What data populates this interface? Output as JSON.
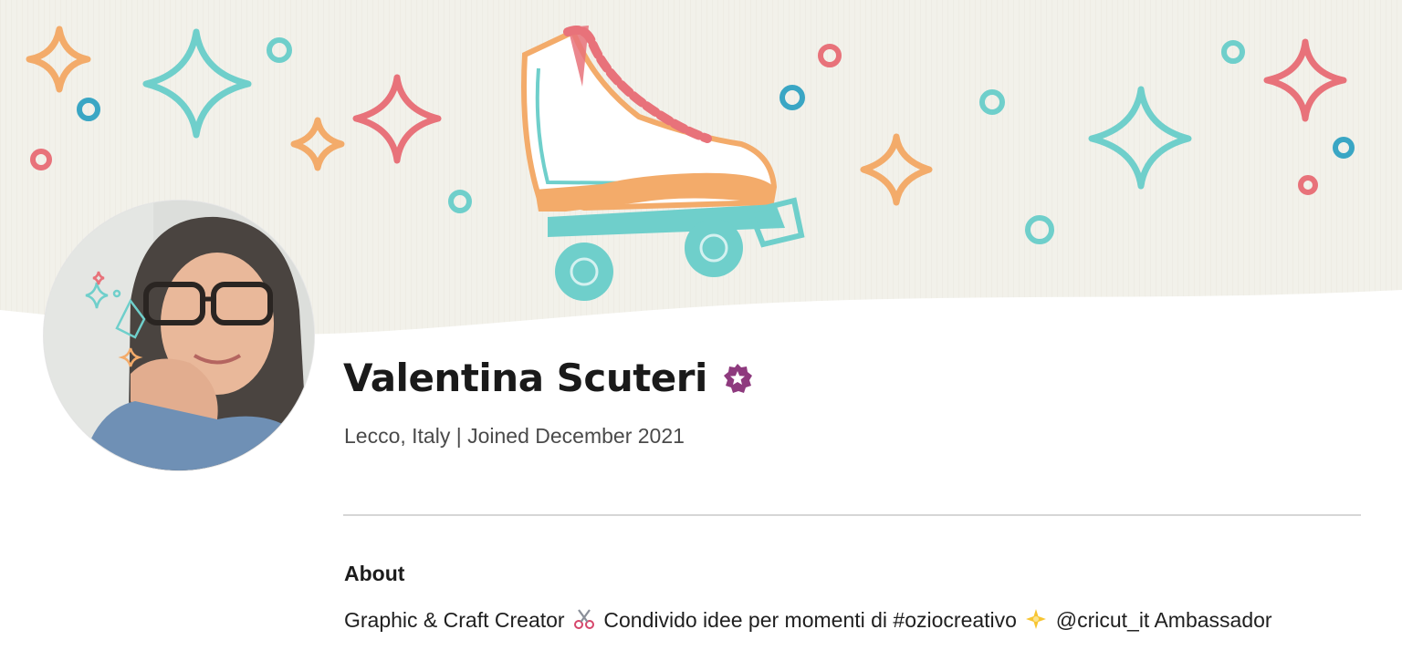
{
  "profile": {
    "name": "Valentina Scuteri",
    "location": "Lecco, Italy",
    "separator": "|",
    "joined": "Joined December 2021",
    "badge_icon": "verified-star-icon",
    "badge_color": "#8e3a7e"
  },
  "about": {
    "heading": "About",
    "text_part1": "Graphic & Craft Creator",
    "text_part2": "Condivido idee per momenti di #oziocreativo",
    "text_part3": "@cricut_it Ambassador",
    "icon_1": "scissors-icon",
    "icon_2": "sparkle-star-icon"
  },
  "banner": {
    "background_color": "#f3f2ec",
    "palette": {
      "teal": "#6fcfcb",
      "coral": "#e8727a",
      "orange": "#f3ab6a",
      "blue": "#3aa6c4"
    }
  }
}
